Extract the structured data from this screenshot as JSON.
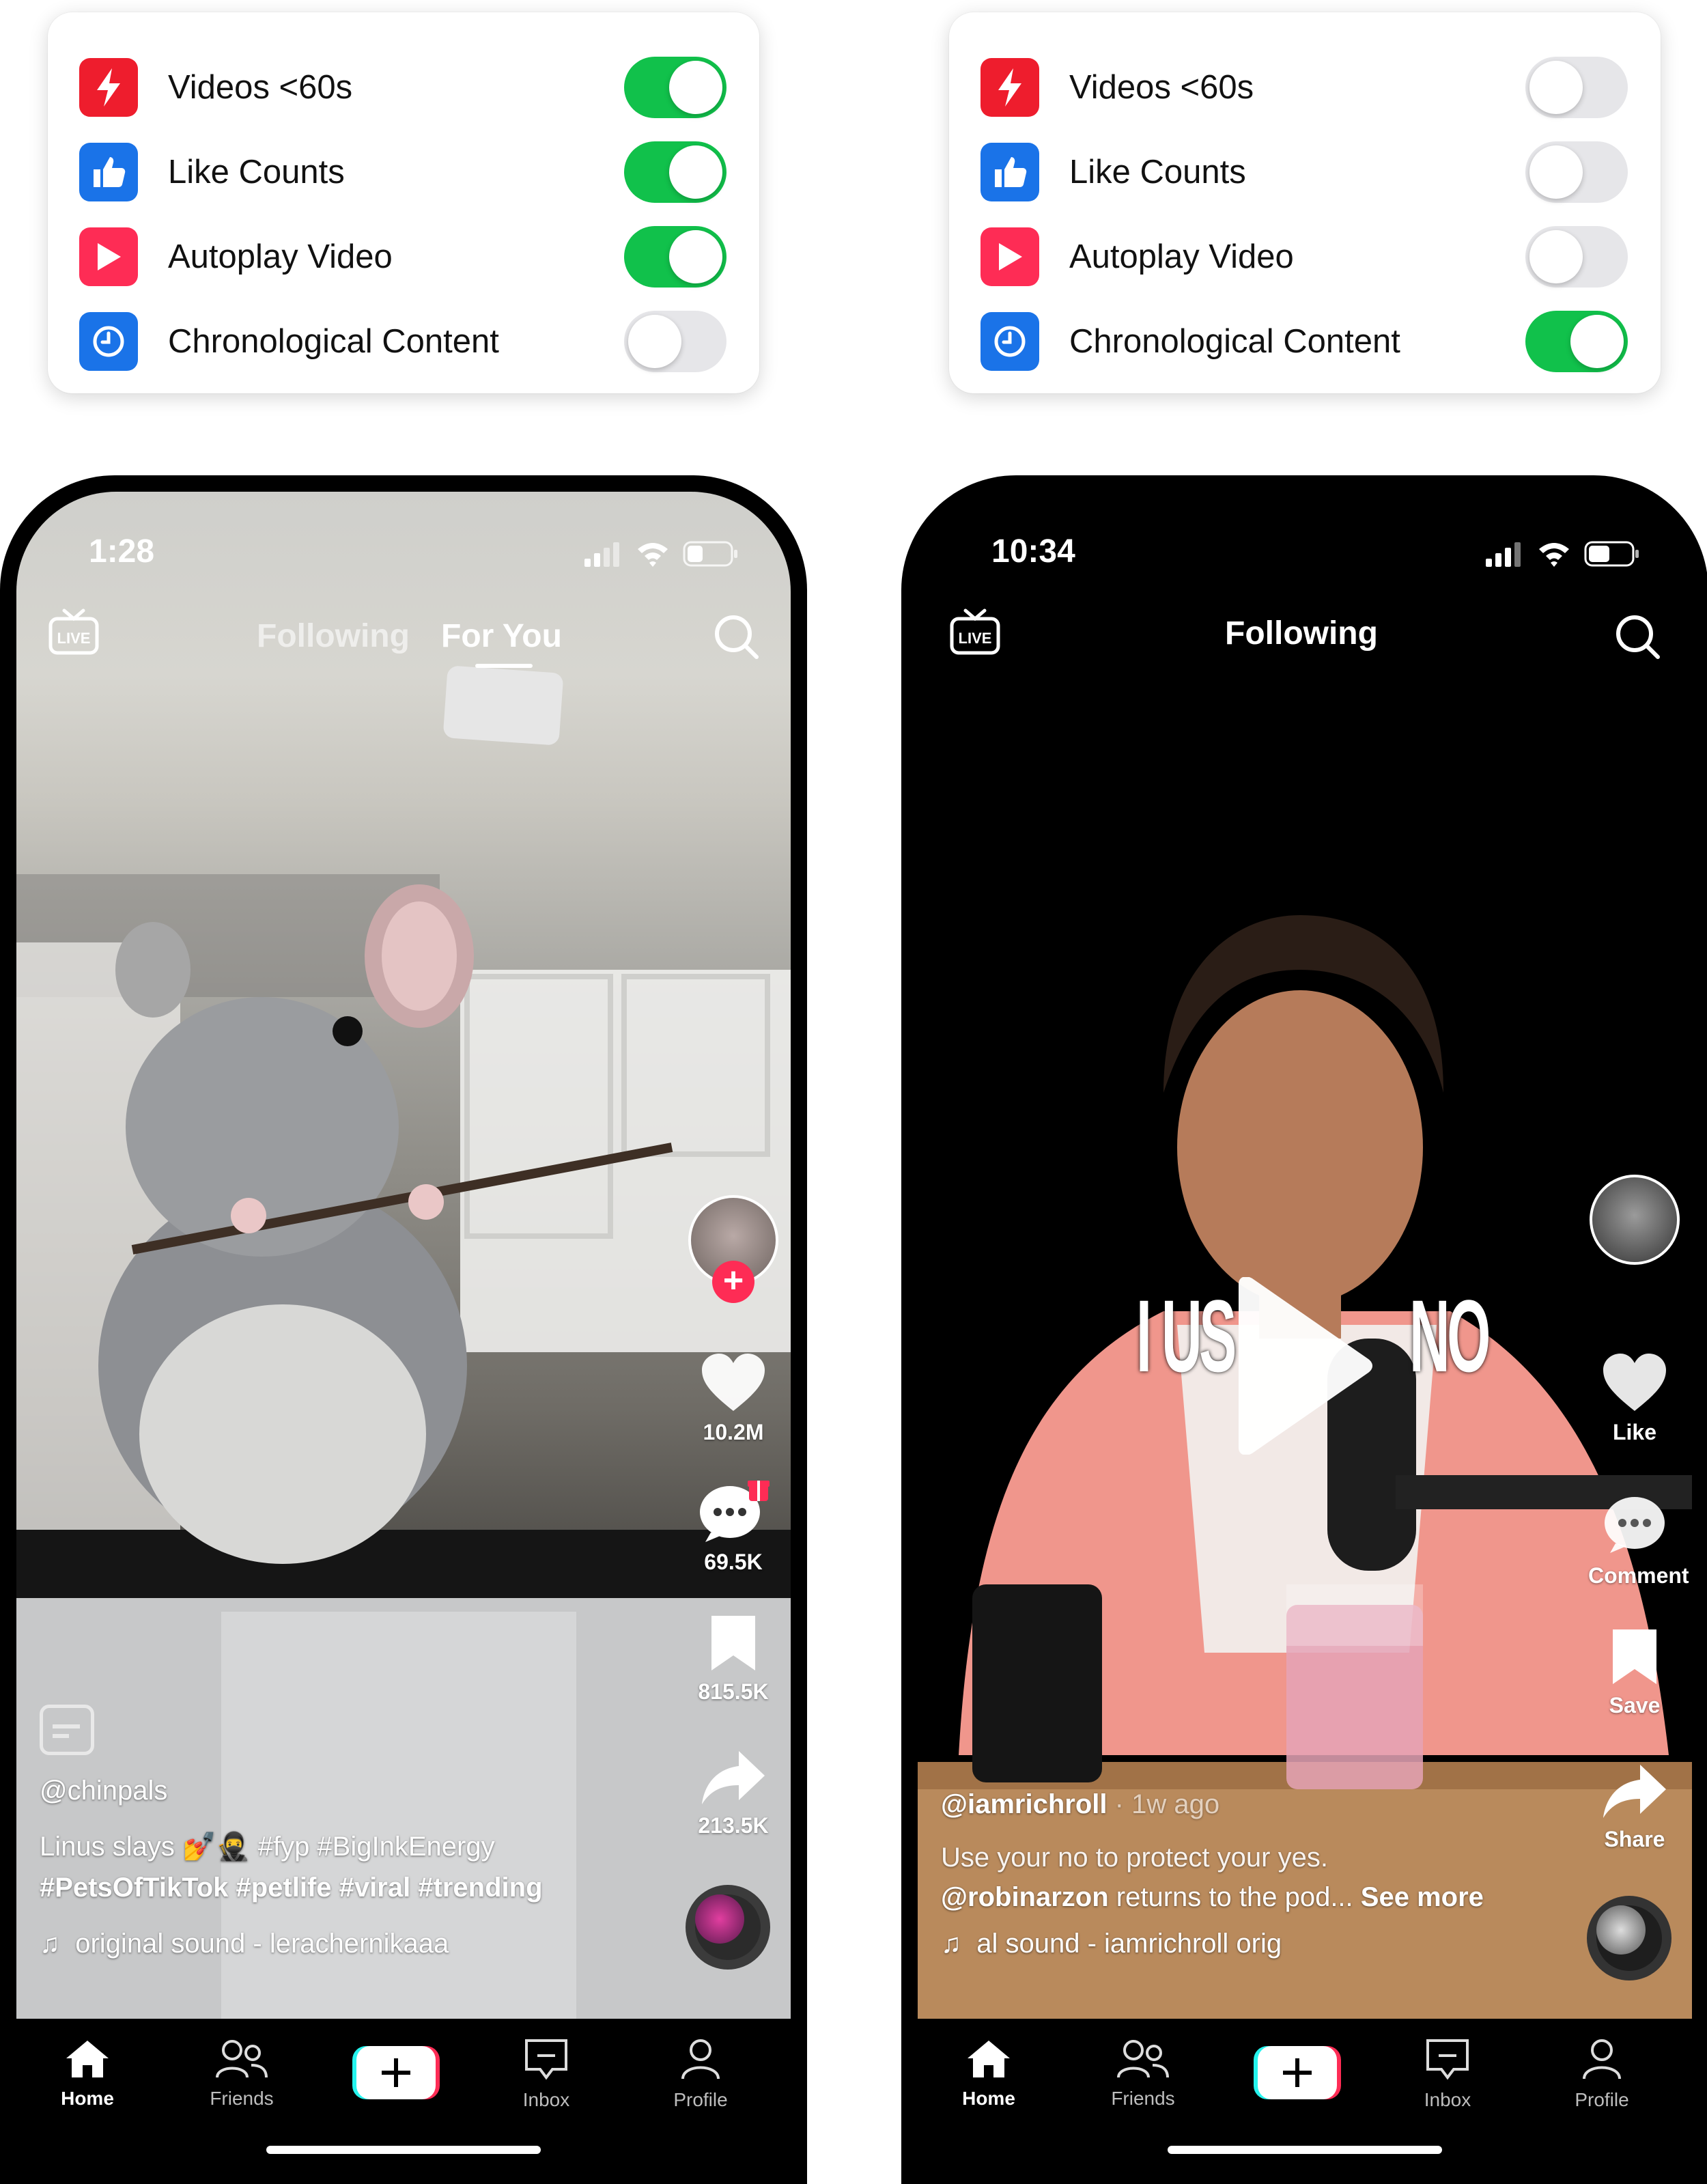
{
  "colors": {
    "toggle_on": "#11c14b",
    "toggle_off": "#e6e6e9",
    "tiktok_red": "#fe2c55",
    "tiktok_cyan": "#25f4ee",
    "icon_blue": "#1a73e8"
  },
  "settings": {
    "left": {
      "rows": [
        {
          "label": "Videos <60s",
          "icon": "lightning-icon",
          "enabled": true
        },
        {
          "label": "Like Counts",
          "icon": "thumbs-up-icon",
          "enabled": true
        },
        {
          "label": "Autoplay Video",
          "icon": "play-icon",
          "enabled": true
        },
        {
          "label": "Chronological Content",
          "icon": "clock-icon",
          "enabled": false
        }
      ]
    },
    "right": {
      "rows": [
        {
          "label": "Videos <60s",
          "icon": "lightning-icon",
          "enabled": false
        },
        {
          "label": "Like Counts",
          "icon": "thumbs-up-icon",
          "enabled": false
        },
        {
          "label": "Autoplay Video",
          "icon": "play-icon",
          "enabled": false
        },
        {
          "label": "Chronological Content",
          "icon": "clock-icon",
          "enabled": true
        }
      ]
    }
  },
  "phone_left": {
    "time": "1:28",
    "tabs": [
      "Following",
      "For You"
    ],
    "active_tab": "For You",
    "side": {
      "likes": "10.2M",
      "comments": "69.5K",
      "saves": "815.5K",
      "shares": "213.5K"
    },
    "username": "@chinpals",
    "caption_line1": "Linus slays 💅🥷 #fyp #BigInkEnergy",
    "caption_line2": "#PetsOfTikTok #petlife #viral #trending",
    "sound": "original sound - lerachernikaaa",
    "nav": [
      "Home",
      "Friends",
      "Inbox",
      "Profile"
    ]
  },
  "phone_right": {
    "time": "10:34",
    "tabs": [
      "Following"
    ],
    "overlay_text": "I US",
    "overlay_text2": "NO",
    "side": {
      "likes": "Like",
      "comments": "Comment",
      "saves": "Save",
      "shares": "Share"
    },
    "username": "@iamrichroll",
    "time_ago": "· 1w ago",
    "caption_line1": "Use your no to protect your yes.",
    "caption_mention": "@robinarzon",
    "caption_line2": " returns to the pod... ",
    "see_more": "See more",
    "sound": "al sound - iamrichroll    orig",
    "nav": [
      "Home",
      "Friends",
      "Inbox",
      "Profile"
    ]
  }
}
